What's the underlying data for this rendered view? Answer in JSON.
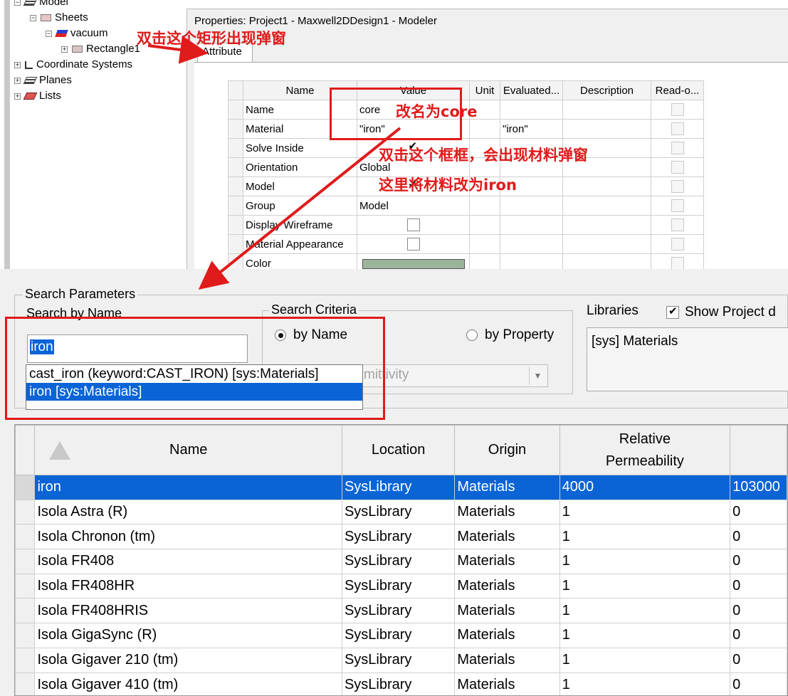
{
  "tree": {
    "model": "Model",
    "sheets": "Sheets",
    "vacuum": "vacuum",
    "rectangle": "Rectangle1",
    "coord_systems": "Coordinate Systems",
    "planes": "Planes",
    "lists": "Lists"
  },
  "props": {
    "title": "Properties: Project1 - Maxwell2DDesign1 - Modeler",
    "tab": "Attribute",
    "headers": [
      "Name",
      "Value",
      "Unit",
      "Evaluated...",
      "Description",
      "Read-o..."
    ],
    "rows": [
      {
        "name": "Name",
        "value": "core",
        "evaluated": ""
      },
      {
        "name": "Material",
        "value": "\"iron\"",
        "evaluated": "\"iron\""
      },
      {
        "name": "Solve Inside",
        "value": "",
        "evaluated": ""
      },
      {
        "name": "Orientation",
        "value": "Global",
        "evaluated": ""
      },
      {
        "name": "Model",
        "value": "",
        "evaluated": ""
      },
      {
        "name": "Group",
        "value": "Model",
        "evaluated": ""
      },
      {
        "name": "Display Wireframe",
        "value": "",
        "evaluated": ""
      },
      {
        "name": "Material Appearance",
        "value": "",
        "evaluated": ""
      },
      {
        "name": "Color",
        "value": "",
        "evaluated": ""
      }
    ],
    "color_swatch": "#9bb59a"
  },
  "search": {
    "params_label": "Search Parameters",
    "by_name_label": "Search by Name",
    "input_value": "iron",
    "criteria_label": "Search Criteria",
    "by_name": "by Name",
    "by_property": "by Property",
    "property_combo": "mittivity",
    "dropdown": [
      "cast_iron (keyword:CAST_IRON) [sys:Materials]",
      "iron [sys:Materials]"
    ],
    "libraries_label": "Libraries",
    "show_project": "Show Project d",
    "library_item": "[sys] Materials"
  },
  "materials": {
    "headers": [
      "Name",
      "Location",
      "Origin",
      "Relative Permeability",
      ""
    ],
    "header_line1_perm": "Relative",
    "header_line2_perm": "Permeability",
    "rows": [
      [
        "iron",
        "SysLibrary",
        "Materials",
        "4000",
        "103000"
      ],
      [
        "Isola Astra (R)",
        "SysLibrary",
        "Materials",
        "1",
        "0"
      ],
      [
        "Isola Chronon (tm)",
        "SysLibrary",
        "Materials",
        "1",
        "0"
      ],
      [
        "Isola FR408",
        "SysLibrary",
        "Materials",
        "1",
        "0"
      ],
      [
        "Isola FR408HR",
        "SysLibrary",
        "Materials",
        "1",
        "0"
      ],
      [
        "Isola FR408HRIS",
        "SysLibrary",
        "Materials",
        "1",
        "0"
      ],
      [
        "Isola GigaSync (R)",
        "SysLibrary",
        "Materials",
        "1",
        "0"
      ],
      [
        "Isola Gigaver 210 (tm)",
        "SysLibrary",
        "Materials",
        "1",
        "0"
      ],
      [
        "Isola Gigaver 410 (tm)",
        "SysLibrary",
        "Materials",
        "1",
        "0"
      ]
    ]
  },
  "annotations": {
    "double_click_rect": "双击这个矩形出现弹窗",
    "rename_core": "改名为core",
    "double_click_box": "双击这个框框，会出现材料弹窗",
    "change_to_iron": "这里将材料改为iron",
    "color": "#e01b1b"
  }
}
